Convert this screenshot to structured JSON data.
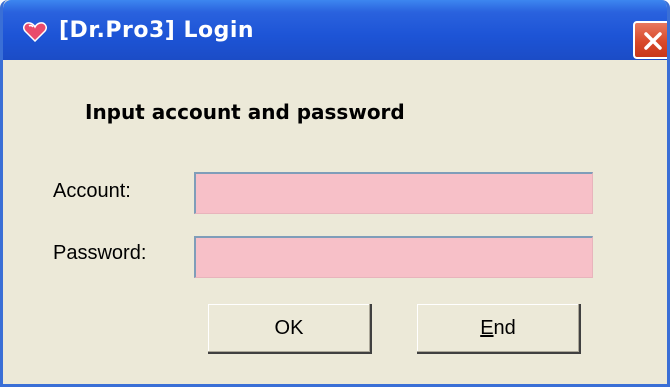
{
  "window": {
    "title": "[Dr.Pro3] Login",
    "icon": "heart-app-icon",
    "close_icon": "close-icon",
    "colors": {
      "titlebar": "#1d54d6",
      "close_button": "#d9492a",
      "dialog_background": "#ece9d8",
      "field_background": "#f7c0c8"
    }
  },
  "dialog": {
    "heading": "Input account and password",
    "account_label": "Account:",
    "account_value": "",
    "password_label": "Password:",
    "password_value": "",
    "ok_label": "OK",
    "end_label_accel": "E",
    "end_label_rest": "nd"
  }
}
